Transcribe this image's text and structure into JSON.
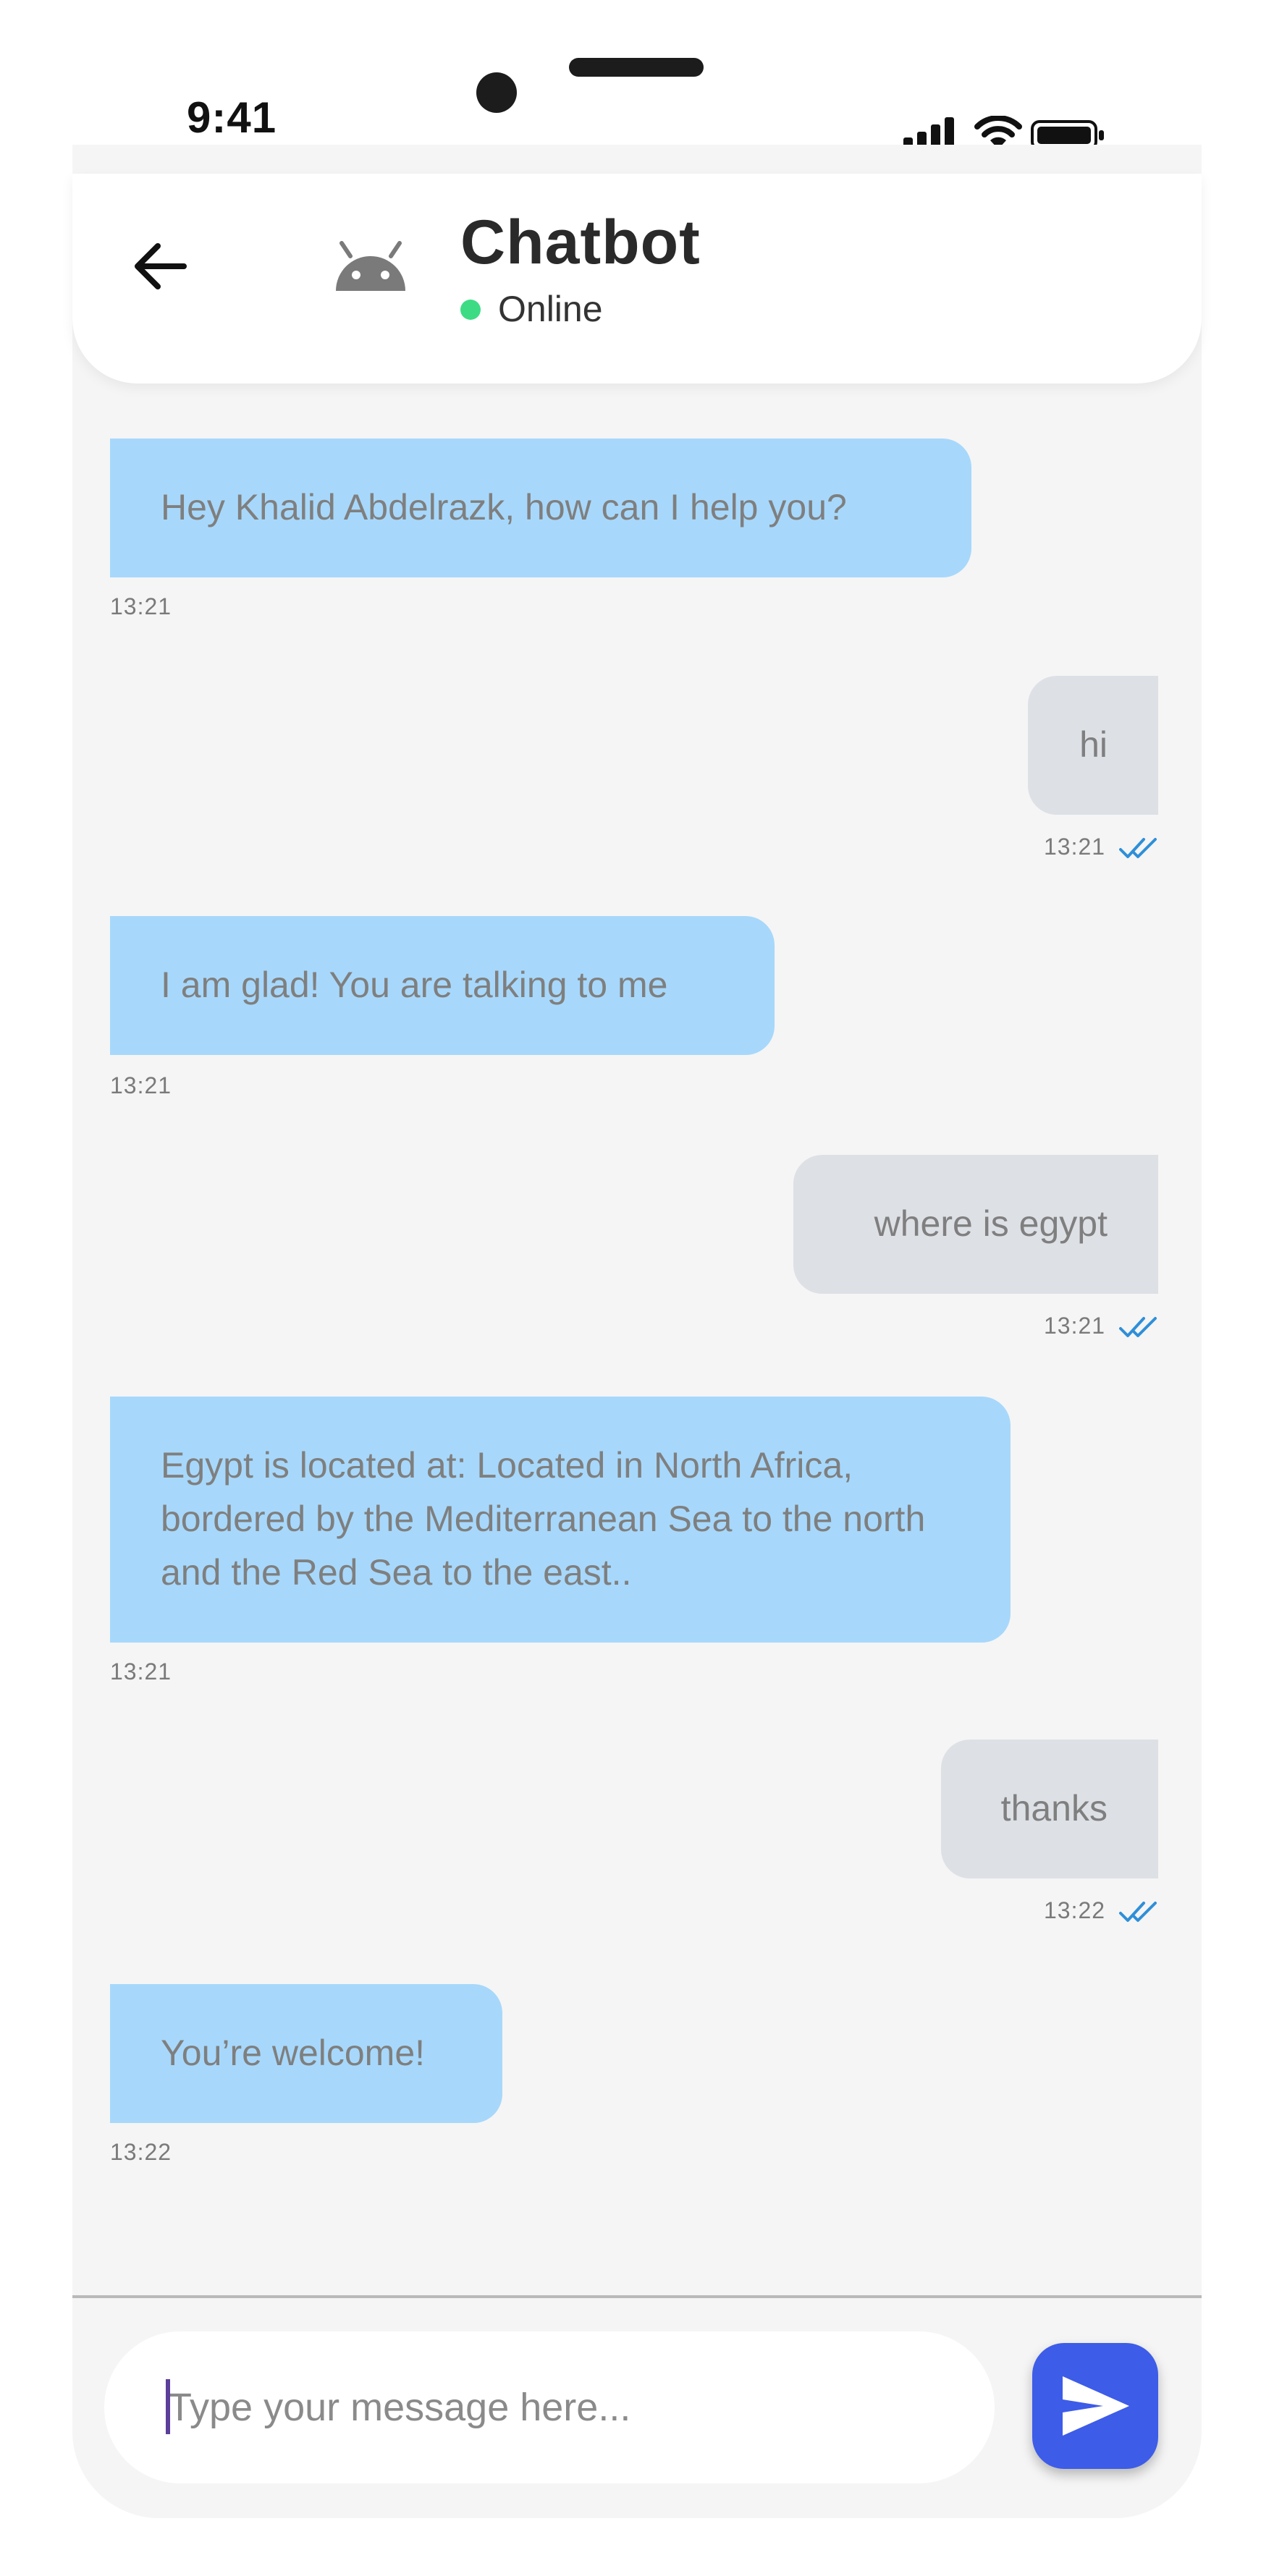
{
  "status_bar": {
    "time": "9:41"
  },
  "header": {
    "title": "Chatbot",
    "status": "Online",
    "status_color": "#3ddc84",
    "back_icon": "arrow-left-icon",
    "avatar_icon": "android-icon"
  },
  "messages": [
    {
      "sender": "bot",
      "text": "Hey Khalid Abdelrazk, how can I help you?",
      "time": "13:21"
    },
    {
      "sender": "user",
      "text": "hi",
      "time": "13:21",
      "read": true
    },
    {
      "sender": "bot",
      "text": "I am glad! You are talking to me",
      "time": "13:21"
    },
    {
      "sender": "user",
      "text": "where is egypt",
      "time": "13:21",
      "read": true
    },
    {
      "sender": "bot",
      "text": "Egypt is located at: Located in North Africa, bordered by the Mediterranean Sea to the north and the Red Sea to the east..",
      "time": "13:21"
    },
    {
      "sender": "user",
      "text": "thanks",
      "time": "13:22",
      "read": true
    },
    {
      "sender": "bot",
      "text": "You’re welcome!",
      "time": "13:22"
    }
  ],
  "composer": {
    "placeholder": "Type your message here...",
    "value": "",
    "send_icon": "send-icon"
  },
  "colors": {
    "bot_bubble": "#a7d8fb",
    "user_bubble": "#dde0e5",
    "send_button": "#3d5ce8",
    "read_check": "#2f8fd8",
    "background": "#f5f5f5"
  }
}
